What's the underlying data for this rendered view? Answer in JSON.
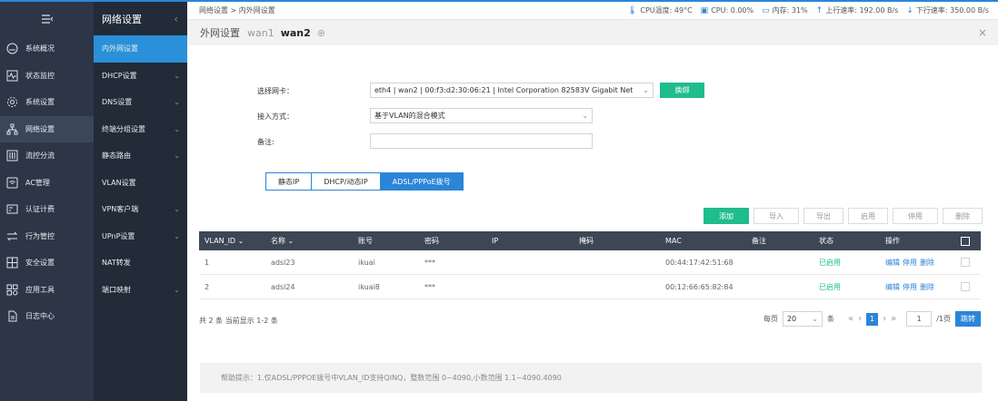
{
  "colors": {
    "accent": "#2b85d8",
    "green": "#1fbc8c",
    "sidebar": "#2c3646",
    "sidebar2": "#222b38",
    "table_header": "#3d4654"
  },
  "sidebar": {
    "collapse_icon": "menu-collapse-icon",
    "items": [
      {
        "label": "系统概况",
        "icon": "dashboard-icon"
      },
      {
        "label": "状态监控",
        "icon": "monitor-icon"
      },
      {
        "label": "系统设置",
        "icon": "gear-icon"
      },
      {
        "label": "网络设置",
        "icon": "network-icon",
        "active": true
      },
      {
        "label": "流控分流",
        "icon": "flow-control-icon"
      },
      {
        "label": "AC管理",
        "icon": "wifi-icon"
      },
      {
        "label": "认证计费",
        "icon": "auth-icon"
      },
      {
        "label": "行为管控",
        "icon": "arrows-icon"
      },
      {
        "label": "安全设置",
        "icon": "security-icon"
      },
      {
        "label": "应用工具",
        "icon": "tools-icon"
      },
      {
        "label": "日志中心",
        "icon": "log-icon"
      }
    ]
  },
  "submenu": {
    "title": "网络设置",
    "items": [
      {
        "label": "内外网设置",
        "active": true,
        "expand": false
      },
      {
        "label": "DHCP设置",
        "expand": true
      },
      {
        "label": "DNS设置",
        "expand": true
      },
      {
        "label": "终端分组设置",
        "expand": true
      },
      {
        "label": "静态路由",
        "expand": true
      },
      {
        "label": "VLAN设置",
        "expand": false
      },
      {
        "label": "VPN客户端",
        "expand": true
      },
      {
        "label": "UPnP设置",
        "expand": true
      },
      {
        "label": "NAT转发",
        "expand": false
      },
      {
        "label": "端口映射",
        "expand": true
      }
    ]
  },
  "topbar": {
    "breadcrumb": "网络设置 > 内外网设置",
    "cpu_temp": "CPU温度: 49°C",
    "cpu": "CPU: 0.00%",
    "mem": "内存: 31%",
    "up": "上行速率: 192.00 B/s",
    "down": "下行速率: 350.00 B/s"
  },
  "page": {
    "title": "外网设置",
    "tab1": "wan1",
    "tab2": "wan2"
  },
  "form": {
    "nic_label": "选择网卡：",
    "nic_value": "eth4 | wan2 | 00:f3:d2:30:06:21 | Intel Corporation 82583V Gigabit Net",
    "bind_button": "换绑",
    "access_label": "接入方式：",
    "access_value": "基于VLAN的混合模式",
    "note_label": "备注:",
    "note_value": ""
  },
  "tabs": [
    {
      "label": "静态IP"
    },
    {
      "label": "DHCP/动态IP"
    },
    {
      "label": "ADSL/PPPoE拨号",
      "active": true
    }
  ],
  "actions": {
    "add": "添加",
    "import": "导入",
    "export": "导出",
    "enable": "启用",
    "disable": "停用",
    "delete": "删除"
  },
  "table": {
    "headers": {
      "vlan_id": "VLAN_ID",
      "name": "名称",
      "account": "账号",
      "password": "密码",
      "ip": "IP",
      "mask": "掩码",
      "mac": "MAC",
      "remark": "备注",
      "status": "状态",
      "ops": "操作"
    },
    "rows": [
      {
        "vlan_id": "1",
        "name": "adsl23",
        "account": "ikuai",
        "password": "***",
        "ip": "",
        "mask": "",
        "mac": "00:44:17:42:51:68",
        "remark": "",
        "status": "已启用",
        "edit": "编辑",
        "stop": "停用",
        "del": "删除"
      },
      {
        "vlan_id": "2",
        "name": "adsl24",
        "account": "ikuai8",
        "password": "***",
        "ip": "",
        "mask": "",
        "mac": "00:12:66:65:82:84",
        "remark": "",
        "status": "已启用",
        "edit": "编辑",
        "stop": "停用",
        "del": "删除"
      }
    ]
  },
  "footer": {
    "summary": "共 2 条 当前显示 1-2 条",
    "per_page_label": "每页",
    "per_page": "20",
    "unit": "条",
    "current_page": "1",
    "page_input": "1",
    "total_pages": "/1页",
    "jump": "跳转"
  },
  "help": "帮助提示：1.仅ADSL/PPPOE拨号中VLAN_ID支持QINQ，整数范围 0~4090,小数范围 1.1~4090.4090"
}
